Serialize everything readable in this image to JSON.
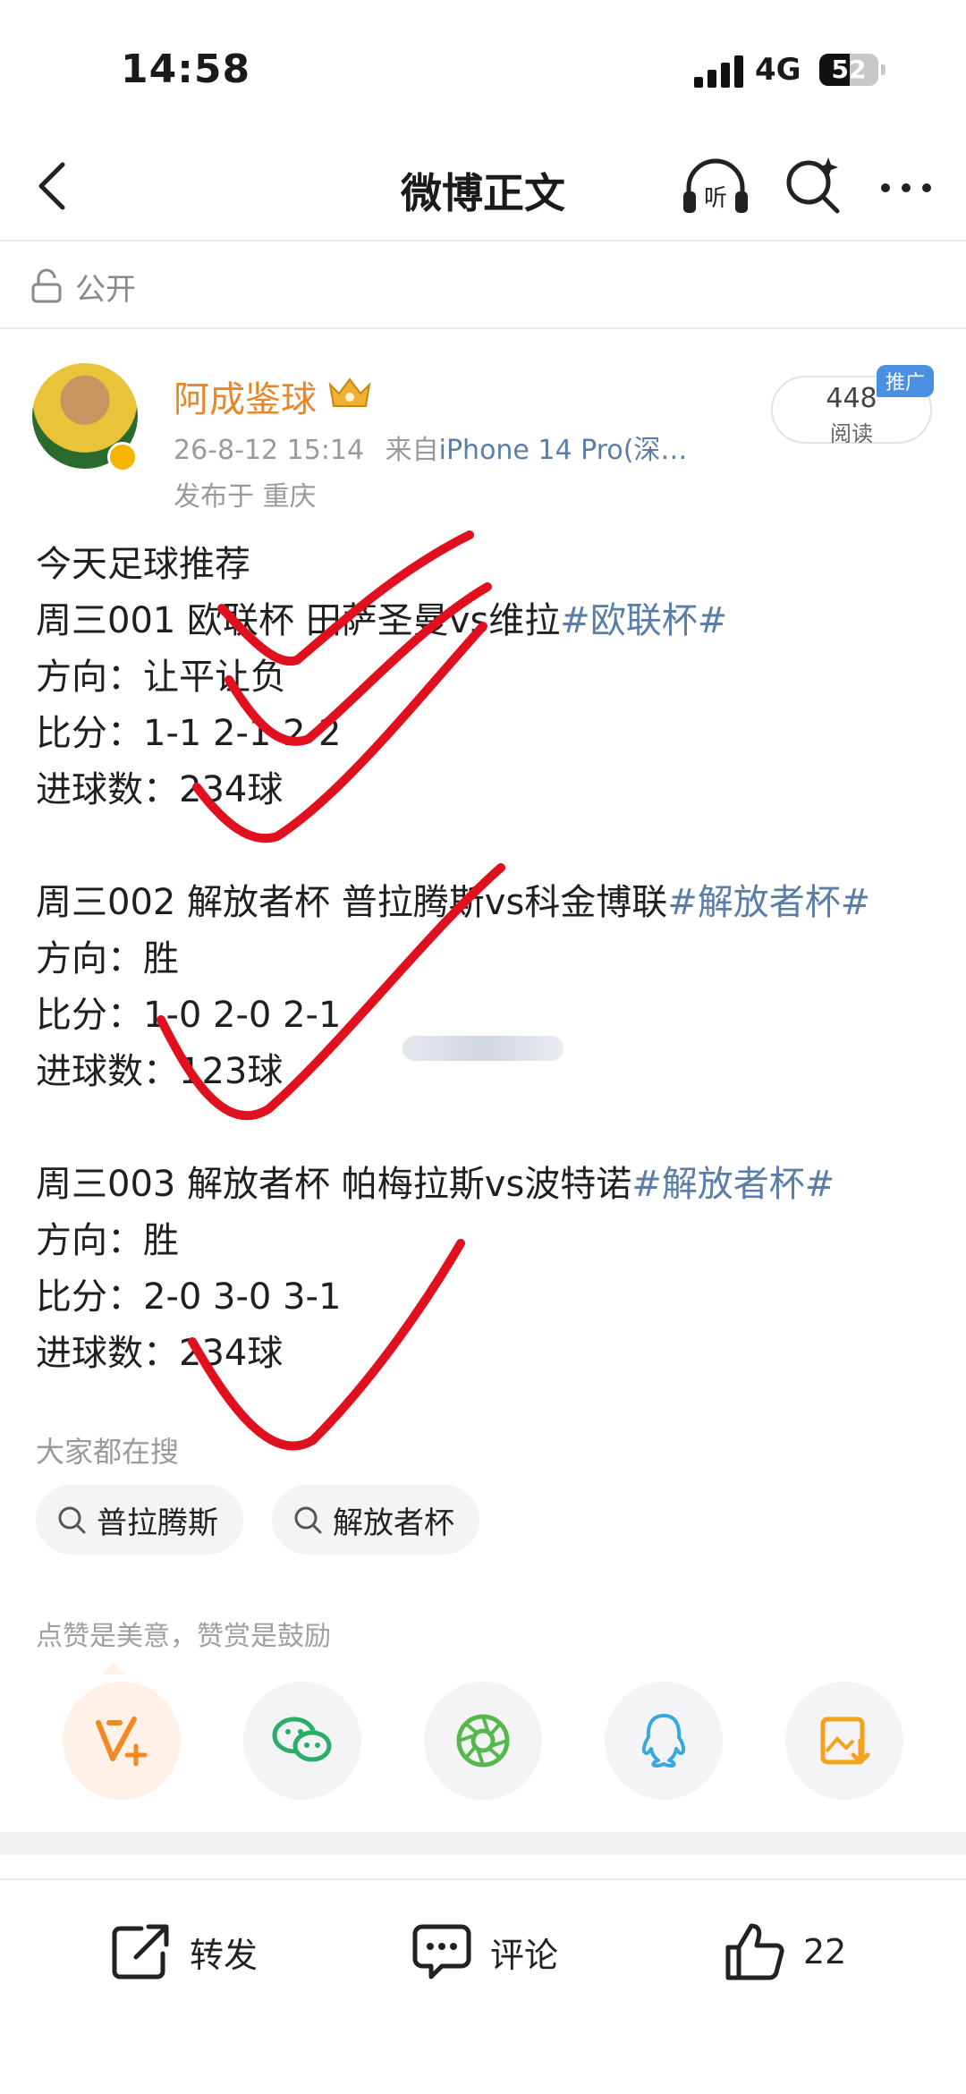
{
  "status_bar": {
    "time": "14:58",
    "network": "4G",
    "battery": "52",
    "battery_level": 0.52
  },
  "nav": {
    "title": "微博正文"
  },
  "visibility": "公开",
  "author": {
    "name": "阿成鉴球",
    "meta_time": "26-8-12 15:14",
    "meta_from": "来自",
    "meta_device": "iPhone 14 Pro(深…",
    "location": "发布于 重庆",
    "reads": "448",
    "reads_label": "阅读",
    "promo": "推广"
  },
  "post": {
    "intro": "今天足球推荐",
    "matches": [
      {
        "title": "周三001 欧联杯 田萨圣曼vs维拉",
        "topic": "#欧联杯#",
        "direction": "方向：让平让负",
        "score": "比分：1-1  2-1  2-2",
        "goals": "进球数：234球"
      },
      {
        "title": "周三002 解放者杯 普拉腾斯vs科金博联",
        "topic": "#解放者杯#",
        "direction": "方向：胜",
        "score": "比分：1-0  2-0  2-1",
        "goals": "进球数：123球"
      },
      {
        "title": "周三003 解放者杯 帕梅拉斯vs波特诺",
        "topic": "#解放者杯#",
        "direction": "方向：胜",
        "score": "比分：2-0  3-0  3-1",
        "goals": "进球数：234球"
      }
    ]
  },
  "hot_search": {
    "title": "大家都在搜",
    "items": [
      "普拉腾斯",
      "解放者杯"
    ]
  },
  "like_note": "点赞是美意，赞赏是鼓励",
  "actions": {
    "repost": "转发",
    "comment": "评论",
    "like_count": "22"
  },
  "colors": {
    "accent_orange": "#e8862a",
    "link_blue": "#5b7ea8",
    "check_red": "#e0101f"
  },
  "icons": [
    "back-icon",
    "listen-icon",
    "search-icon",
    "more-icon",
    "lock-icon",
    "crown-icon",
    "reward-icon",
    "wechat-icon",
    "moments-icon",
    "qq-icon",
    "save-image-icon",
    "repost-icon",
    "comment-icon",
    "like-icon"
  ]
}
